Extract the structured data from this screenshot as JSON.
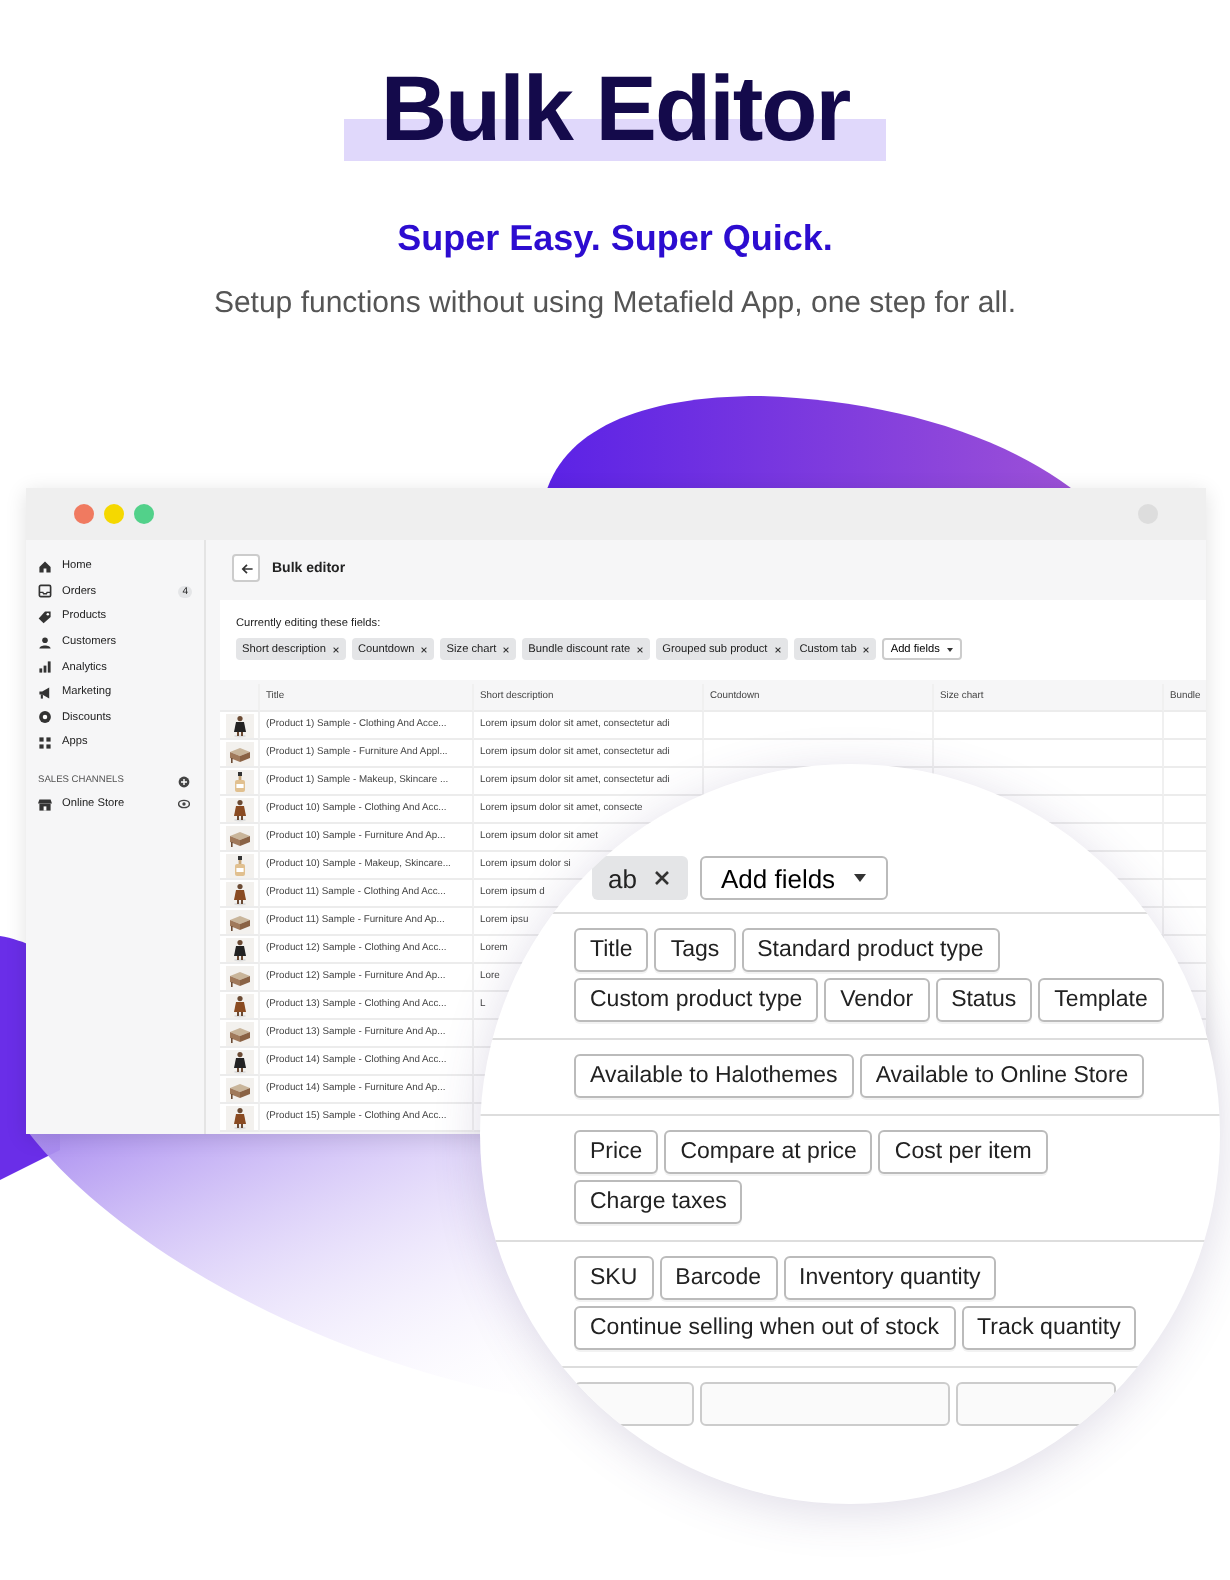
{
  "hero": {
    "title": "Bulk Editor",
    "tagline": "Super Easy. Super Quick.",
    "subtitle": "Setup functions without using Metafield App, one step for all."
  },
  "sidebar": {
    "items": [
      {
        "label": "Home"
      },
      {
        "label": "Orders",
        "badge": "4"
      },
      {
        "label": "Products"
      },
      {
        "label": "Customers"
      },
      {
        "label": "Analytics"
      },
      {
        "label": "Marketing"
      },
      {
        "label": "Discounts"
      },
      {
        "label": "Apps"
      }
    ],
    "section_title": "SALES CHANNELS",
    "channels": [
      {
        "label": "Online Store"
      }
    ]
  },
  "page": {
    "title": "Bulk editor",
    "editing_label": "Currently editing these fields:",
    "fields": [
      "Short description",
      "Countdown",
      "Size chart",
      "Bundle discount rate",
      "Grouped sub product",
      "Custom tab"
    ],
    "add_button": "Add fields"
  },
  "table": {
    "columns": [
      "Title",
      "Short description",
      "Countdown",
      "Size chart",
      "Bundle"
    ],
    "rows": [
      {
        "title": "(Product 1) Sample - Clothing And Acce...",
        "short_description": "Lorem ipsum dolor sit amet, consectetur adi"
      },
      {
        "title": "(Product 1) Sample - Furniture And Appl...",
        "short_description": "Lorem ipsum dolor sit amet, consectetur adi"
      },
      {
        "title": "(Product 1) Sample - Makeup, Skincare ...",
        "short_description": "Lorem ipsum dolor sit amet, consectetur adi"
      },
      {
        "title": "(Product 10) Sample - Clothing And Acc...",
        "short_description": "Lorem ipsum dolor sit amet, consecte"
      },
      {
        "title": "(Product 10) Sample - Furniture And Ap...",
        "short_description": "Lorem ipsum dolor sit amet"
      },
      {
        "title": "(Product 10) Sample - Makeup, Skincare...",
        "short_description": "Lorem ipsum dolor si"
      },
      {
        "title": "(Product 11) Sample - Clothing And Acc...",
        "short_description": "Lorem ipsum d"
      },
      {
        "title": "(Product 11) Sample - Furniture And Ap...",
        "short_description": "Lorem ipsu"
      },
      {
        "title": "(Product 12) Sample - Clothing And Acc...",
        "short_description": "Lorem"
      },
      {
        "title": "(Product 12) Sample - Furniture And Ap...",
        "short_description": "Lore"
      },
      {
        "title": "(Product 13) Sample - Clothing And Acc...",
        "short_description": "L"
      },
      {
        "title": "(Product 13) Sample - Furniture And Ap..."
      },
      {
        "title": "(Product 14) Sample - Clothing And Acc..."
      },
      {
        "title": "(Product 14) Sample - Furniture And Ap..."
      },
      {
        "title": "(Product 15) Sample - Clothing And Acc..."
      }
    ]
  },
  "magnifier": {
    "chip": "ab",
    "add_button": "Add fields",
    "groups": [
      {
        "lines": [
          [
            "Title",
            "Tags",
            "Standard product type"
          ],
          [
            "Custom product type",
            "Vendor",
            "Status",
            "Template"
          ]
        ]
      },
      {
        "lines": [
          [
            "Available to Halothemes",
            "Available to Online Store"
          ]
        ]
      },
      {
        "lines": [
          [
            "Price",
            "Compare at price",
            "Cost per item"
          ],
          [
            "Charge taxes"
          ]
        ]
      },
      {
        "lines": [
          [
            "SKU",
            "Barcode",
            "Inventory quantity"
          ],
          [
            "Continue selling when out of stock",
            "Track quantity"
          ]
        ]
      }
    ]
  }
}
